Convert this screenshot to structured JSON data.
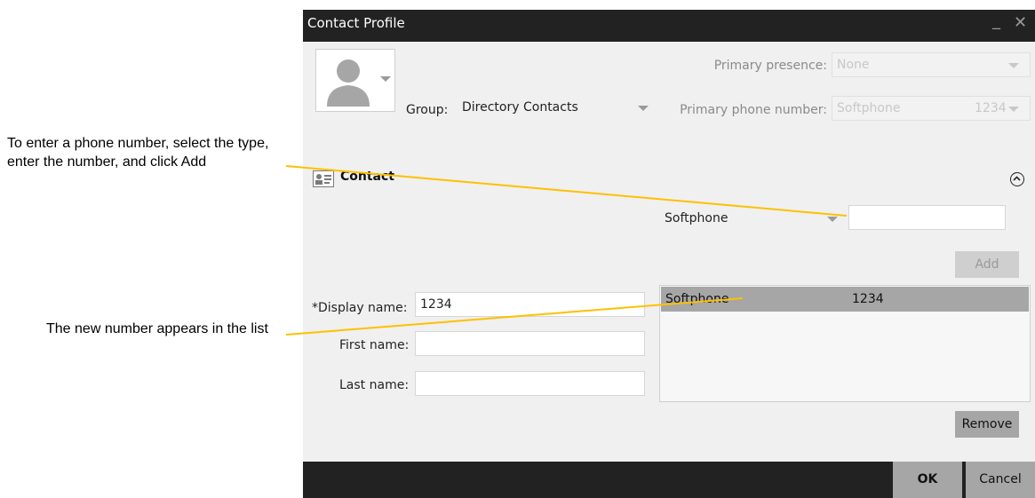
{
  "annotations": {
    "phone_instructions": "To enter a phone number, select the type, enter the number, and click Add",
    "list_note": "The new number appears in the list"
  },
  "dialog": {
    "title": "Contact Profile",
    "minimize_glyph": "_",
    "close_glyph": "✕"
  },
  "header": {
    "group_label": "Group:",
    "group_value": "Directory Contacts",
    "primary_presence_label": "Primary presence:",
    "primary_presence_value": "None",
    "primary_phone_label": "Primary phone number:",
    "primary_phone_type": "Softphone",
    "primary_phone_number": "1234"
  },
  "contact_section": {
    "title": "Contact",
    "phone_type_value": "Softphone",
    "phone_number_value": "",
    "add_label": "Add",
    "remove_label": "Remove",
    "display_name_label": "*Display name:",
    "display_name_value": "1234",
    "first_name_label": "First name:",
    "first_name_value": "",
    "last_name_label": "Last name:",
    "last_name_value": "",
    "phone_list": [
      {
        "type": "Softphone",
        "number": "1234"
      }
    ]
  },
  "footer": {
    "ok_label": "OK",
    "cancel_label": "Cancel"
  },
  "colors": {
    "titlebar": "#222222",
    "annotation_line": "#ffc000",
    "selected_row": "#a6a6a6"
  }
}
